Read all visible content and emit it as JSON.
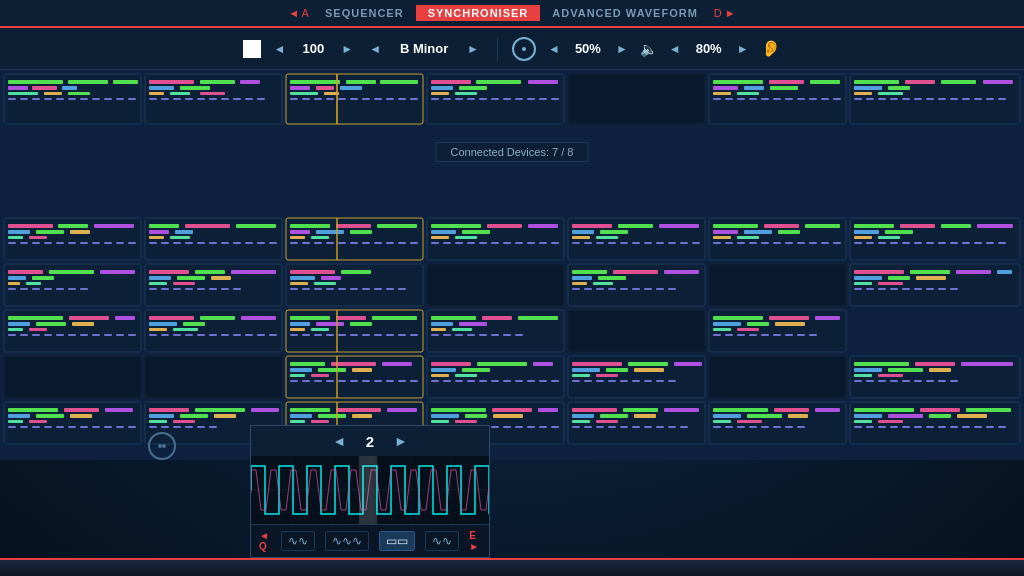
{
  "nav": {
    "left_bracket": "◄ A",
    "items": [
      {
        "label": "SEQUENCER",
        "active": false
      },
      {
        "label": "SYNCHRONISER",
        "active": true
      },
      {
        "label": "ADVANCED WAVEFORM",
        "active": false
      }
    ],
    "right_bracket": "D ►"
  },
  "controls": {
    "stop_label": "■",
    "tempo_prev": "◄",
    "tempo_value": "100",
    "tempo_next": "►",
    "key_prev": "◄",
    "key_value": "B Minor",
    "key_next": "►",
    "volume_prev": "◄",
    "volume_value": "50%",
    "volume_next": "►",
    "output_prev": "◄",
    "output_value": "80%",
    "output_next": "►"
  },
  "connected": {
    "label": "Connected Devices: 7 / 8"
  },
  "waveform": {
    "prev": "◄",
    "value": "2",
    "next": "►"
  },
  "bottom_toolbar": {
    "bracket_left": "◄ Q",
    "wave1": "∿∿",
    "wave2": "∿∿∿",
    "wave3": "▭▭",
    "wave4": "∿∿",
    "bracket_right": "E ►"
  }
}
